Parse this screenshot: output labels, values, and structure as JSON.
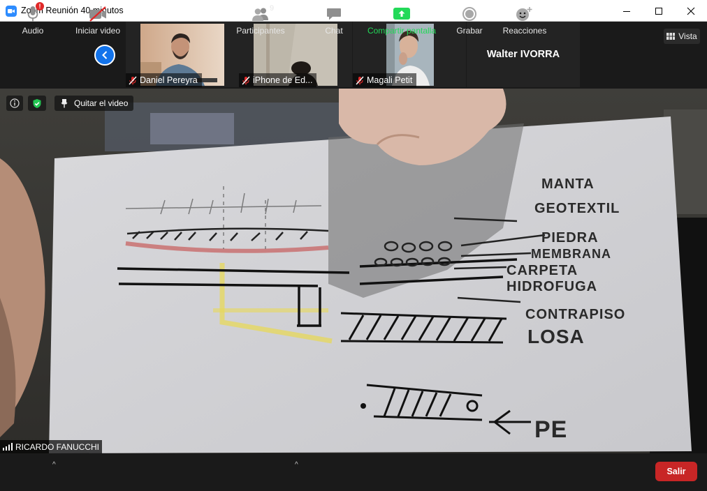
{
  "window": {
    "title": "Zoom Reunión 40 minutos"
  },
  "participants_strip": {
    "tiles": [
      {
        "name": "Daniel Pereyra",
        "muted": true
      },
      {
        "name": "iPhone de Ed...",
        "muted": true
      },
      {
        "name": "Magali Petit",
        "muted": true
      }
    ],
    "name_only_tile": "Walter IVORRA",
    "view_button": "Vista"
  },
  "main_video": {
    "pin_label": "Quitar el video",
    "speaker_name": "RICARDO FANUCCHI",
    "sketch_words": [
      "MANTA",
      "GEOTEXTIL",
      "PIEDRA",
      "MEMBRANA",
      "CARPETA",
      "HIDROFUGA",
      "CONTRAPISO",
      "LOSA",
      "PE"
    ]
  },
  "toolbar": {
    "audio": "Audio",
    "audio_badge": "!",
    "video": "Iniciar video",
    "participants": "Participantes",
    "participants_count": "9",
    "chat": "Chat",
    "share": "Compartir pantalla",
    "record": "Grabar",
    "reactions": "Reacciones",
    "leave": "Salir"
  },
  "colors": {
    "zoom_blue": "#2D8CFF",
    "share_green": "#23d959",
    "leave_red": "#c82626",
    "muted_red": "#e02828"
  }
}
